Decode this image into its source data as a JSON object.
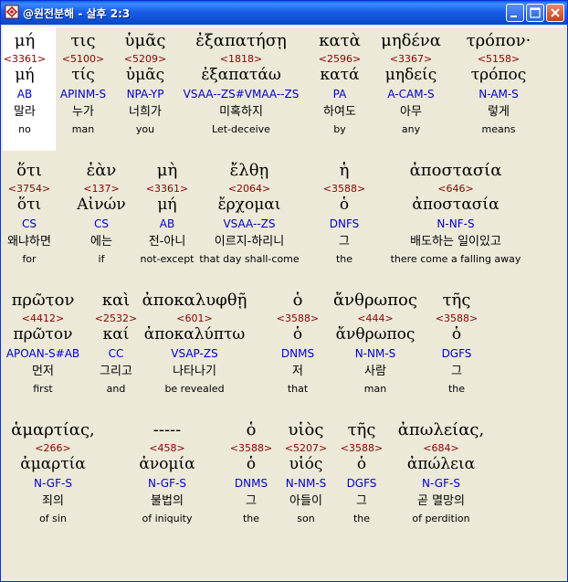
{
  "window": {
    "title": "@원전분해 - 살후 2:3",
    "controls": {
      "minimize": "minimize-icon",
      "maximize": "maximize-icon",
      "close": "close-icon"
    }
  },
  "rows": [
    {
      "words": [
        {
          "greek": "μή",
          "strong": "<3361>",
          "lemma": "μή",
          "parse": "AB",
          "korean": "말라",
          "english": "no",
          "selected": true
        },
        {
          "greek": "τις",
          "strong": "<5100>",
          "lemma": "τίς",
          "parse": "APINM-S",
          "korean": "누가",
          "english": "man"
        },
        {
          "greek": "ὑμᾶς",
          "strong": "<5209>",
          "lemma": "ὑμᾶς",
          "parse": "NPA-YP",
          "korean": "너희가",
          "english": "you"
        },
        {
          "greek": "ἐξαπατήσῃ",
          "strong": "<1818>",
          "lemma": "ἐξαπατάω",
          "parse": "VSAA--ZS#VMAA--ZS",
          "korean": "미혹하지",
          "english": "Let-deceive"
        },
        {
          "greek": "κατὰ",
          "strong": "<2596>",
          "lemma": "κατά",
          "parse": "PA",
          "korean": "하여도",
          "english": "by"
        },
        {
          "greek": "μηδένα",
          "strong": "<3367>",
          "lemma": "μηδείς",
          "parse": "A-CAM-S",
          "korean": "아무",
          "english": "any"
        },
        {
          "greek": "τρόπον·",
          "strong": "<5158>",
          "lemma": "τρόπος",
          "parse": "N-AM-S",
          "korean": "렇게",
          "english": "means"
        }
      ]
    },
    {
      "words": [
        {
          "greek": "ὅτι",
          "strong": "<3754>",
          "lemma": "ὅτι",
          "parse": "CS",
          "korean": "왜냐하면",
          "english": "for"
        },
        {
          "greek": "ἐὰν",
          "strong": "<137>",
          "lemma": "Αἰνών",
          "parse": "CS",
          "korean": "에는",
          "english": "if"
        },
        {
          "greek": "μὴ",
          "strong": "<3361>",
          "lemma": "μή",
          "parse": "AB",
          "korean": "전-아니",
          "english": "not-except"
        },
        {
          "greek": "ἔλθῃ",
          "strong": "<2064>",
          "lemma": "ἔρχομαι",
          "parse": "VSAA--ZS",
          "korean": "이르지-하리니",
          "english": "that day shall-come"
        },
        {
          "greek": "ἡ",
          "strong": "<3588>",
          "lemma": "ὁ",
          "parse": "DNFS",
          "korean": "그",
          "english": "the"
        },
        {
          "greek": "ἀποστασία",
          "strong": "<646>",
          "lemma": "ἀποστασία",
          "parse": "N-NF-S",
          "korean": "배도하는 일이있고",
          "english": "there come a falling away"
        }
      ]
    },
    {
      "words": [
        {
          "greek": "πρῶτον",
          "strong": "<4412>",
          "lemma": "πρῶτον",
          "parse": "APOAN-S#AB",
          "korean": "먼저",
          "english": "first"
        },
        {
          "greek": "καὶ",
          "strong": "<2532>",
          "lemma": "καί",
          "parse": "CC",
          "korean": "그리고",
          "english": "and"
        },
        {
          "greek": "ἀποκαλυφθῇ",
          "strong": "<601>",
          "lemma": "ἀποκαλύπτω",
          "parse": "VSAP-ZS",
          "korean": "나타나기",
          "english": "be revealed"
        },
        {
          "greek": "ὁ",
          "strong": "<3588>",
          "lemma": "ὁ",
          "parse": "DNMS",
          "korean": "저",
          "english": "that"
        },
        {
          "greek": "ἄνθρωπος",
          "strong": "<444>",
          "lemma": "ἄνθρωπος",
          "parse": "N-NM-S",
          "korean": "사람",
          "english": "man"
        },
        {
          "greek": "τῆς",
          "strong": "<3588>",
          "lemma": "ὁ",
          "parse": "DGFS",
          "korean": "그",
          "english": "the"
        }
      ]
    },
    {
      "words": [
        {
          "greek": "ἁμαρτίας,",
          "strong": "<266>",
          "lemma": "ἁμαρτία",
          "parse": "N-GF-S",
          "korean": "죄의",
          "english": "of sin"
        },
        {
          "greek": "-----",
          "strong": "<458>",
          "lemma": "ἀνομία",
          "parse": "N-GF-S",
          "korean": "불법의",
          "english": "of iniquity"
        },
        {
          "greek": "ὁ",
          "strong": "<3588>",
          "lemma": "ὁ",
          "parse": "DNMS",
          "korean": "그",
          "english": "the"
        },
        {
          "greek": "υἱὸς",
          "strong": "<5207>",
          "lemma": "υἱός",
          "parse": "N-NM-S",
          "korean": "아들이",
          "english": "son"
        },
        {
          "greek": "τῆς",
          "strong": "<3588>",
          "lemma": "ὁ",
          "parse": "DGFS",
          "korean": "그",
          "english": "the"
        },
        {
          "greek": "ἀπωλείας,",
          "strong": "<684>",
          "lemma": "ἀπώλεια",
          "parse": "N-GF-S",
          "korean": "곧 멸망의",
          "english": "of perdition"
        }
      ]
    }
  ]
}
